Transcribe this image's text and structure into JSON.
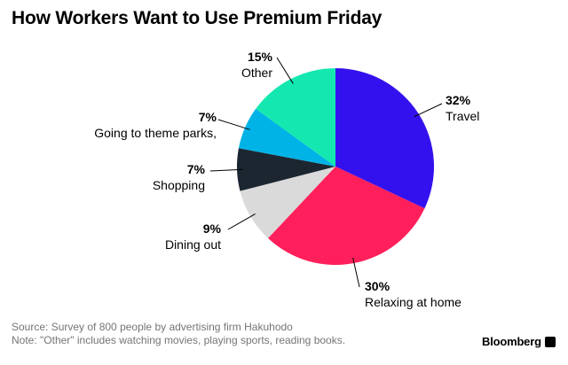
{
  "title": "How Workers Want to Use Premium Friday",
  "chart_data": {
    "type": "pie",
    "title": "How Workers Want to Use Premium Friday",
    "slices": [
      {
        "label": "Travel",
        "value": 32,
        "display": "32%",
        "color": "#3311ee"
      },
      {
        "label": "Relaxing at home",
        "value": 30,
        "display": "30%",
        "color": "#ff1f5b"
      },
      {
        "label": "Dining out",
        "value": 9,
        "display": "9%",
        "color": "#dadada"
      },
      {
        "label": "Shopping",
        "value": 7,
        "display": "7%",
        "color": "#1c2631"
      },
      {
        "label": "Going to theme parks,",
        "value": 7,
        "display": "7%",
        "color": "#00b3e6"
      },
      {
        "label": "Other",
        "value": 15,
        "display": "15%",
        "color": "#14e8b0"
      }
    ]
  },
  "footer": {
    "source": "Source: Survey of 800 people by advertising firm Hakuhodo",
    "note": "Note: \"Other\" includes watching movies, playing sports, reading books."
  },
  "brand": "Bloomberg"
}
